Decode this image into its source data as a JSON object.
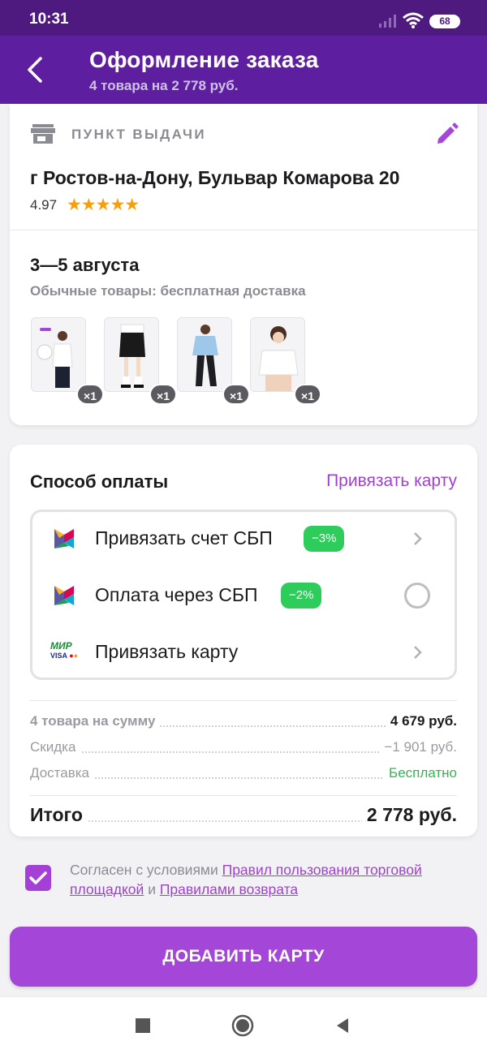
{
  "status_bar": {
    "time": "10:31",
    "battery": "68"
  },
  "header": {
    "title": "Оформление заказа",
    "subtitle": "4 товара на 2 778 руб."
  },
  "pickup": {
    "label": "ПУНКТ ВЫДАЧИ",
    "address": "г Ростов-на-Дону, Бульвар Комарова 20",
    "rating": "4.97",
    "stars": "★★★★★"
  },
  "delivery": {
    "dates": "3—5 августа",
    "note": "Обычные товары: бесплатная доставка",
    "items": [
      {
        "qty": "×1"
      },
      {
        "qty": "×1"
      },
      {
        "qty": "×1"
      },
      {
        "qty": "×1"
      }
    ]
  },
  "payment": {
    "title": "Способ оплаты",
    "link": "Привязать карту",
    "options": [
      {
        "label": "Привязать счет СБП",
        "badge": "−3%"
      },
      {
        "label": "Оплата через СБП",
        "badge": "−2%"
      },
      {
        "label": "Привязать карту",
        "mir": "МИР",
        "visa": "VISA"
      }
    ]
  },
  "summary": {
    "items_label": "4 товара на сумму",
    "items_value": "4 679 руб.",
    "discount_label": "Скидка",
    "discount_value": "−1 901 руб.",
    "delivery_label": "Доставка",
    "delivery_value": "Бесплатно",
    "total_label": "Итого",
    "total_value": "2 778 руб."
  },
  "agreement": {
    "prefix": "Согласен с условиями ",
    "link1": "Правил пользования торговой площадкой",
    "middle": " и ",
    "link2": "Правилами возврата"
  },
  "cta": {
    "label": "ДОБАВИТЬ КАРТУ"
  },
  "colors": {
    "brand": "#5e1ea0",
    "accent": "#a447d8",
    "discount": "#2ecc5a",
    "free": "#2eb84f"
  }
}
